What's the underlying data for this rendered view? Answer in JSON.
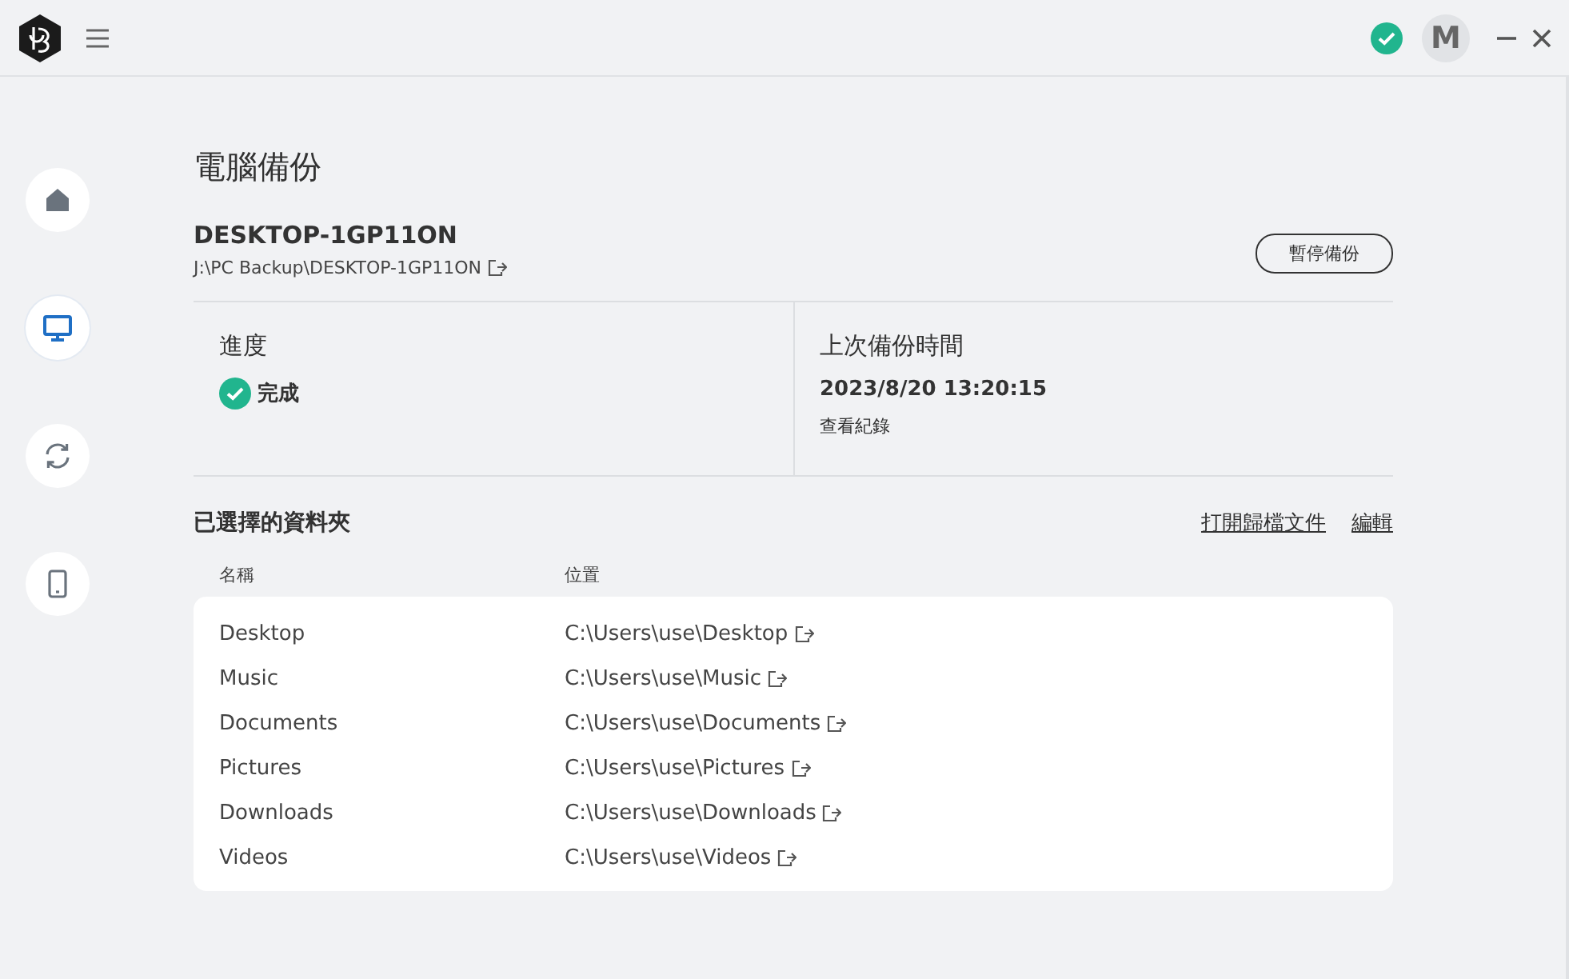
{
  "header": {
    "avatar": "M"
  },
  "sidebar": {
    "items": [
      {
        "kind": "home",
        "selected": false
      },
      {
        "kind": "computer",
        "selected": true
      },
      {
        "kind": "sync",
        "selected": false
      },
      {
        "kind": "phone",
        "selected": false
      }
    ]
  },
  "page": {
    "title": "電腦備份",
    "device_name": "DESKTOP-1GP11ON",
    "device_path": "J:\\PC Backup\\DESKTOP-1GP11ON",
    "pause_button": "暫停備份"
  },
  "progress": {
    "label": "進度",
    "status": "完成"
  },
  "last_backup": {
    "label": "上次備份時間",
    "time": "2023/8/20 13:20:15",
    "log_link": "查看紀錄"
  },
  "folders": {
    "title": "已選擇的資料夾",
    "links": [
      "打開歸檔文件",
      "編輯"
    ],
    "columns": [
      "名稱",
      "位置"
    ],
    "rows": [
      {
        "name": "Desktop",
        "path": "C:\\Users\\use\\Desktop"
      },
      {
        "name": "Music",
        "path": "C:\\Users\\use\\Music"
      },
      {
        "name": "Documents",
        "path": "C:\\Users\\use\\Documents"
      },
      {
        "name": "Pictures",
        "path": "C:\\Users\\use\\Pictures"
      },
      {
        "name": "Downloads",
        "path": "C:\\Users\\use\\Downloads"
      },
      {
        "name": "Videos",
        "path": "C:\\Users\\use\\Videos"
      }
    ]
  }
}
